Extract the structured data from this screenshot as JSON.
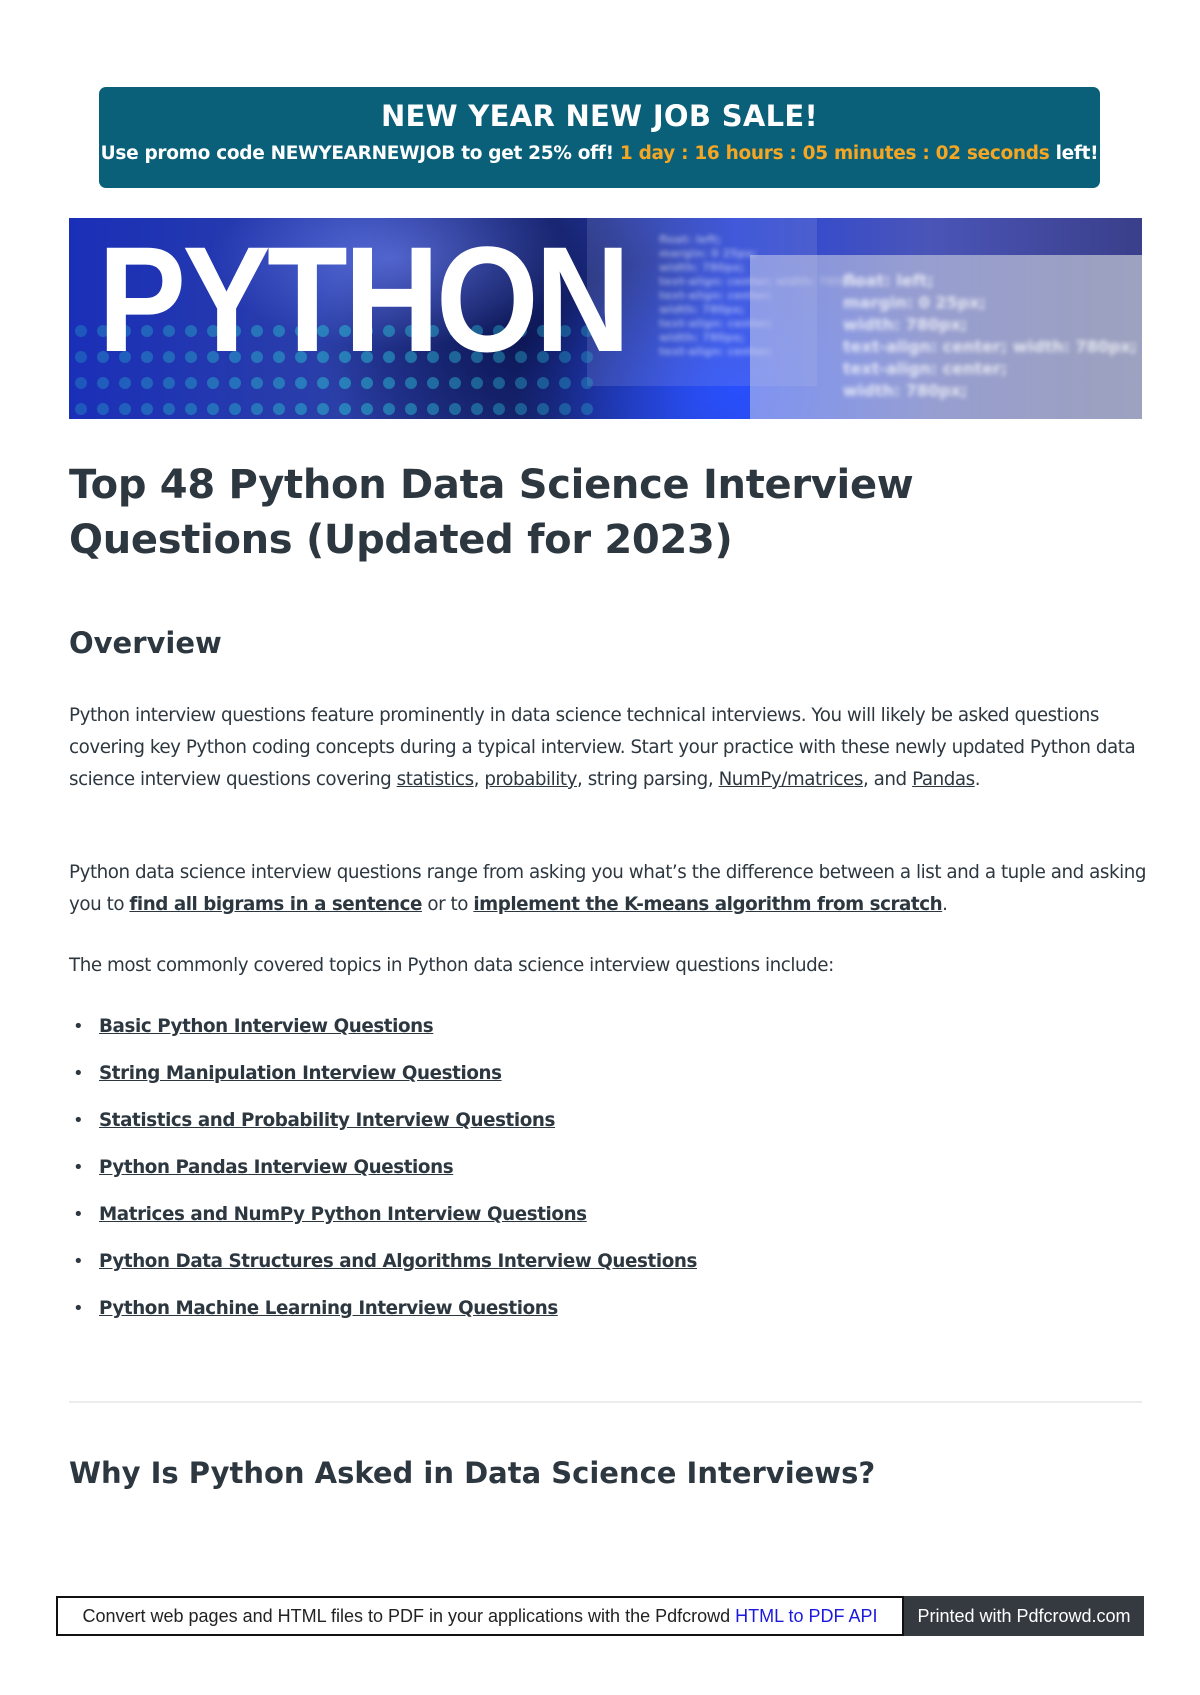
{
  "promo": {
    "title": "NEW YEAR NEW JOB SALE!",
    "text_before": "Use promo code NEWYEARNEWJOB to get 25% off!",
    "countdown": "1 day : 16 hours : 05 minutes : 02 seconds",
    "text_after": "left!",
    "background_color": "#0a6079",
    "countdown_color": "#f5a623"
  },
  "hero": {
    "word": "PYTHON",
    "code_small": "float: left;\nmargin: 0 25px;\nwidth: 780px;\ntext-align: center; width: 780px;\ntext-align: center;\nwidth: 780px;\ntext-align: center;\nwidth: 780px;\ntext-align: center;",
    "code_big": "float: left;\nmargin: 0 25px;\nwidth: 780px;\ntext-align: center; width: 780px;\ntext-align: center;\nwidth: 780px;"
  },
  "article": {
    "title": "Top 48 Python Data Science Interview Questions (Updated for 2023)",
    "overview_heading": "Overview",
    "p1": {
      "text1": "Python interview questions feature prominently in data science technical interviews. You will likely be asked questions covering key Python coding concepts during a typical interview. Start your practice with these newly updated Python data science interview questions covering ",
      "link_statistics": "statistics",
      "sep1": ", ",
      "link_probability": "probability",
      "text2": ", string parsing, ",
      "link_numpy": "NumPy/matrices",
      "text3": ", and ",
      "link_pandas": "Pandas",
      "text4": "."
    },
    "p2": {
      "text1": "Python data science interview questions range from asking you what’s the difference between a list and a tuple and asking you to ",
      "link_bigrams": "find all bigrams in a sentence",
      "text2": " or to ",
      "link_kmeans": "implement the K-means algorithm from scratch",
      "text3": "."
    },
    "p3": "The most commonly covered topics in Python data science interview questions include:",
    "topics": [
      "Basic Python Interview Questions",
      "String Manipulation Interview Questions",
      "Statistics and Probability Interview Questions",
      "Python Pandas Interview Questions",
      "Matrices and NumPy Python Interview Questions",
      "Python Data Structures and Algorithms Interview Questions",
      "Python Machine Learning Interview Questions"
    ],
    "bullet": "•",
    "why_heading": "Why Is Python Asked in Data Science Interviews?"
  },
  "footer": {
    "left_text": "Convert web pages and HTML files to PDF in your applications with the Pdfcrowd ",
    "left_link": "HTML to PDF API",
    "right_text": "Printed with Pdfcrowd.com"
  }
}
